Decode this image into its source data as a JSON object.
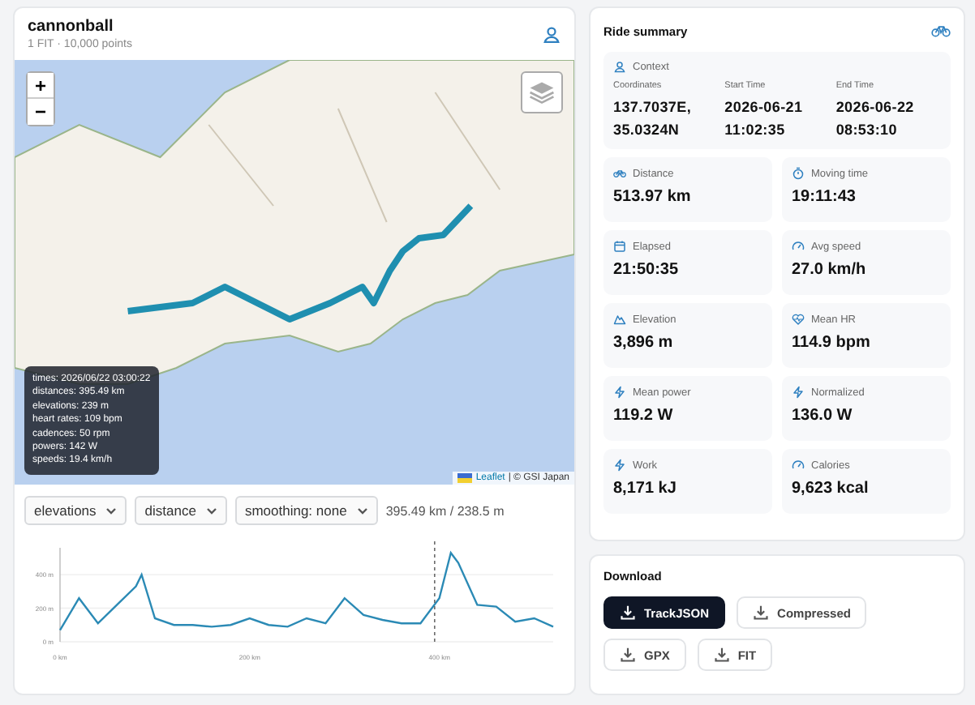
{
  "track": {
    "title": "cannonball",
    "subtitle": "1 FIT · 10,000 points"
  },
  "map": {
    "zoom_buttons": [
      "+",
      "−"
    ],
    "tooltip": [
      "times: 2026/06/22 03:00:22",
      "distances: 395.49 km",
      "elevations: 239 m",
      "heart rates: 109 bpm",
      "cadences: 50 rpm",
      "powers: 142 W",
      "speeds: 19.4 km/h"
    ],
    "attribution": {
      "link": "Leaflet",
      "text": "| © GSI Japan"
    }
  },
  "chart_controls": {
    "selects": [
      "elevations",
      "distance",
      "smoothing: none"
    ],
    "readout": "395.49 km / 238.5 m"
  },
  "elevation_chart": {
    "chart_data": {
      "type": "line",
      "x": [
        0,
        20,
        40,
        60,
        80,
        86,
        100,
        120,
        140,
        160,
        180,
        200,
        220,
        240,
        260,
        280,
        300,
        320,
        340,
        360,
        380,
        400,
        412,
        420,
        440,
        460,
        480,
        500,
        520
      ],
      "series": [
        {
          "color": "#2b8ab5",
          "values": [
            70,
            260,
            110,
            220,
            330,
            400,
            140,
            100,
            100,
            90,
            100,
            140,
            100,
            90,
            140,
            110,
            260,
            160,
            130,
            110,
            110,
            260,
            530,
            470,
            220,
            210,
            120,
            140,
            90
          ]
        }
      ],
      "xlim": [
        0,
        520
      ],
      "ylim": [
        0,
        560
      ],
      "xticks": [
        {
          "value": 0,
          "label": "0 km"
        },
        {
          "value": 200,
          "label": "200 km"
        },
        {
          "value": 400,
          "label": "400 km"
        }
      ],
      "yticks": [
        {
          "value": 0,
          "label": "0 m"
        },
        {
          "value": 200,
          "label": "200 m"
        },
        {
          "value": 400,
          "label": "400 m"
        }
      ],
      "ref_lines": [
        {
          "axis": "x",
          "value": 395
        }
      ]
    }
  },
  "ride_summary": {
    "title": "Ride summary",
    "context": {
      "title": "Context",
      "fields": [
        {
          "label": "Coordinates",
          "value": "137.7037E, 35.0324N"
        },
        {
          "label": "Start Time",
          "value": "2026-06-21 11:02:35"
        },
        {
          "label": "End Time",
          "value": "2026-06-22 08:53:10"
        }
      ]
    },
    "stats": [
      {
        "kind": "bike",
        "label": "Distance",
        "value": "513.97 km"
      },
      {
        "kind": "timer",
        "label": "Moving time",
        "value": "19:11:43"
      },
      {
        "kind": "calendar",
        "label": "Elapsed",
        "value": "21:50:35"
      },
      {
        "kind": "gauge",
        "label": "Avg speed",
        "value": "27.0 km/h"
      },
      {
        "kind": "mountain",
        "label": "Elevation",
        "value": "3,896 m"
      },
      {
        "kind": "heart",
        "label": "Mean HR",
        "value": "114.9 bpm"
      },
      {
        "kind": "bolt",
        "label": "Mean power",
        "value": "119.2 W"
      },
      {
        "kind": "bolt",
        "label": "Normalized",
        "value": "136.0 W"
      },
      {
        "kind": "bolt",
        "label": "Work",
        "value": "8,171 kJ"
      },
      {
        "kind": "gauge",
        "label": "Calories",
        "value": "9,623 kcal"
      }
    ]
  },
  "download": {
    "title": "Download",
    "buttons": [
      {
        "label": "TrackJSON",
        "selected": true
      },
      {
        "label": "Compressed",
        "selected": false
      },
      {
        "label": "GPX",
        "selected": false
      },
      {
        "label": "FIT",
        "selected": false
      }
    ]
  }
}
